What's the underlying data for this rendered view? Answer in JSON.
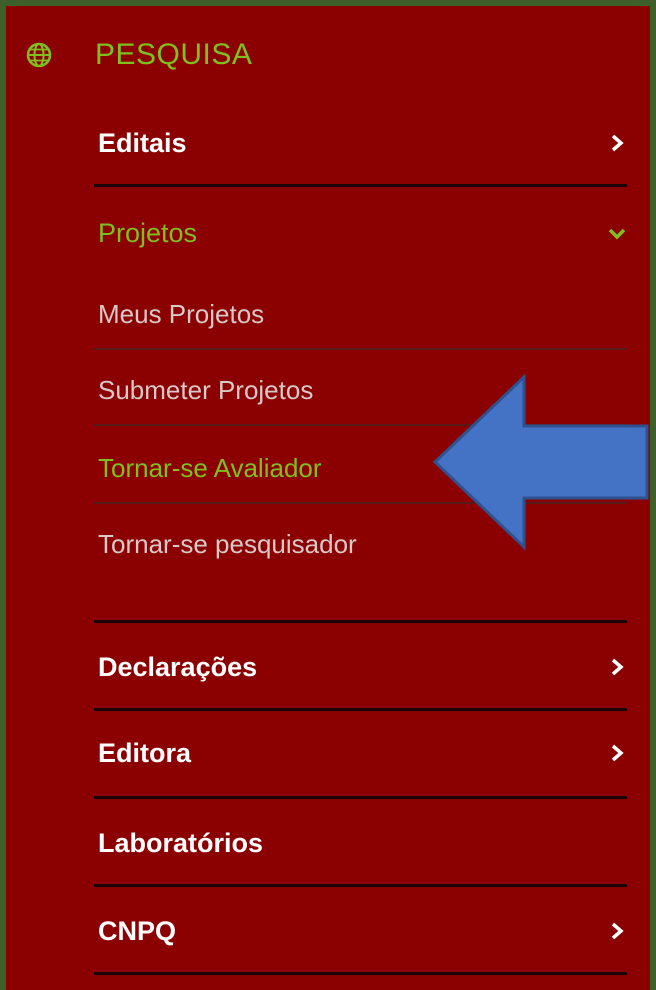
{
  "section": {
    "title": "PESQUISA",
    "icon": "globe-icon"
  },
  "menu": {
    "editais": {
      "label": "Editais",
      "icon": "chevron-right-icon"
    },
    "projetos": {
      "label": "Projetos",
      "icon": "chevron-down-icon",
      "expanded": true,
      "subitems": [
        {
          "label": "Meus Projetos"
        },
        {
          "label": "Submeter Projetos"
        },
        {
          "label": "Tornar-se Avaliador"
        },
        {
          "label": "Tornar-se pesquisador"
        }
      ]
    },
    "declaracoes": {
      "label": "Declarações",
      "icon": "chevron-right-icon"
    },
    "editora": {
      "label": "Editora",
      "icon": "chevron-right-icon"
    },
    "laboratorios": {
      "label": "Laboratórios"
    },
    "cnpq": {
      "label": "CNPQ",
      "icon": "chevron-right-icon"
    }
  },
  "annotation": {
    "pointer": "arrow-left-icon",
    "target": "Tornar-se Avaliador"
  },
  "colors": {
    "outer_background": "#3d5f2a",
    "panel_background": "#8b0000",
    "accent_green": "#7fbf1e",
    "text_white": "#ffffff",
    "text_muted": "#d9c8c8",
    "arrow_blue": "#4472c4"
  }
}
